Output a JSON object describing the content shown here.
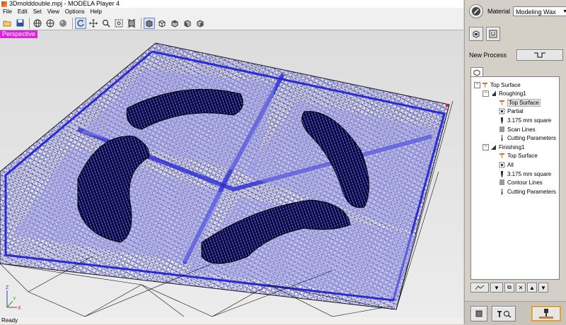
{
  "window": {
    "title": "3Dmolddouble.mpj - MODELA Player 4"
  },
  "menu": [
    "File",
    "Edit",
    "Set",
    "View",
    "Options",
    "Help"
  ],
  "toolbar": {
    "buttons": [
      "open-icon",
      "save-icon",
      "sep",
      "globe-icon",
      "globe-wire-icon",
      "sphere-icon",
      "sep",
      "rotate-icon",
      "move-icon",
      "zoom-icon",
      "zoom-window-icon",
      "fit-icon",
      "sep",
      "solid-view-icon",
      "wire-view-icon",
      "top-view-icon",
      "front-view-icon",
      "side-view-icon"
    ]
  },
  "viewport": {
    "mode_label": "Perspective"
  },
  "status": {
    "text": "Ready"
  },
  "panel": {
    "material_label": "Material",
    "material_value": "Modeling Wax",
    "new_process_label": "New Process",
    "tree": [
      {
        "label": "Top Surface",
        "indent": 0,
        "icon": "tool-icon",
        "expander": "−"
      },
      {
        "label": "Roughing1",
        "indent": 1,
        "icon": "roughing-icon",
        "expander": "−"
      },
      {
        "label": "Top Surface",
        "indent": 2,
        "icon": "tool-icon",
        "selected": true
      },
      {
        "label": "Partial",
        "indent": 2,
        "icon": "area-icon"
      },
      {
        "label": "3.175 mm square",
        "indent": 2,
        "icon": "bit-icon"
      },
      {
        "label": "Scan Lines",
        "indent": 2,
        "icon": "lines-icon"
      },
      {
        "label": "Cutting Parameters",
        "indent": 2,
        "icon": "info-icon"
      },
      {
        "label": "Finishing1",
        "indent": 1,
        "icon": "finishing-icon",
        "expander": "−"
      },
      {
        "label": "Top Surface",
        "indent": 2,
        "icon": "tool-icon"
      },
      {
        "label": "All",
        "indent": 2,
        "icon": "area-icon"
      },
      {
        "label": "3.175 mm square",
        "indent": 2,
        "icon": "bit-icon"
      },
      {
        "label": "Contour Lines",
        "indent": 2,
        "icon": "lines-icon"
      },
      {
        "label": "Cutting Parameters",
        "indent": 2,
        "icon": "info-icon"
      }
    ],
    "colors": {
      "highlight": "#e020e0",
      "wire_blue": "#2a2ad8",
      "cut_orange": "#e8a020"
    }
  }
}
